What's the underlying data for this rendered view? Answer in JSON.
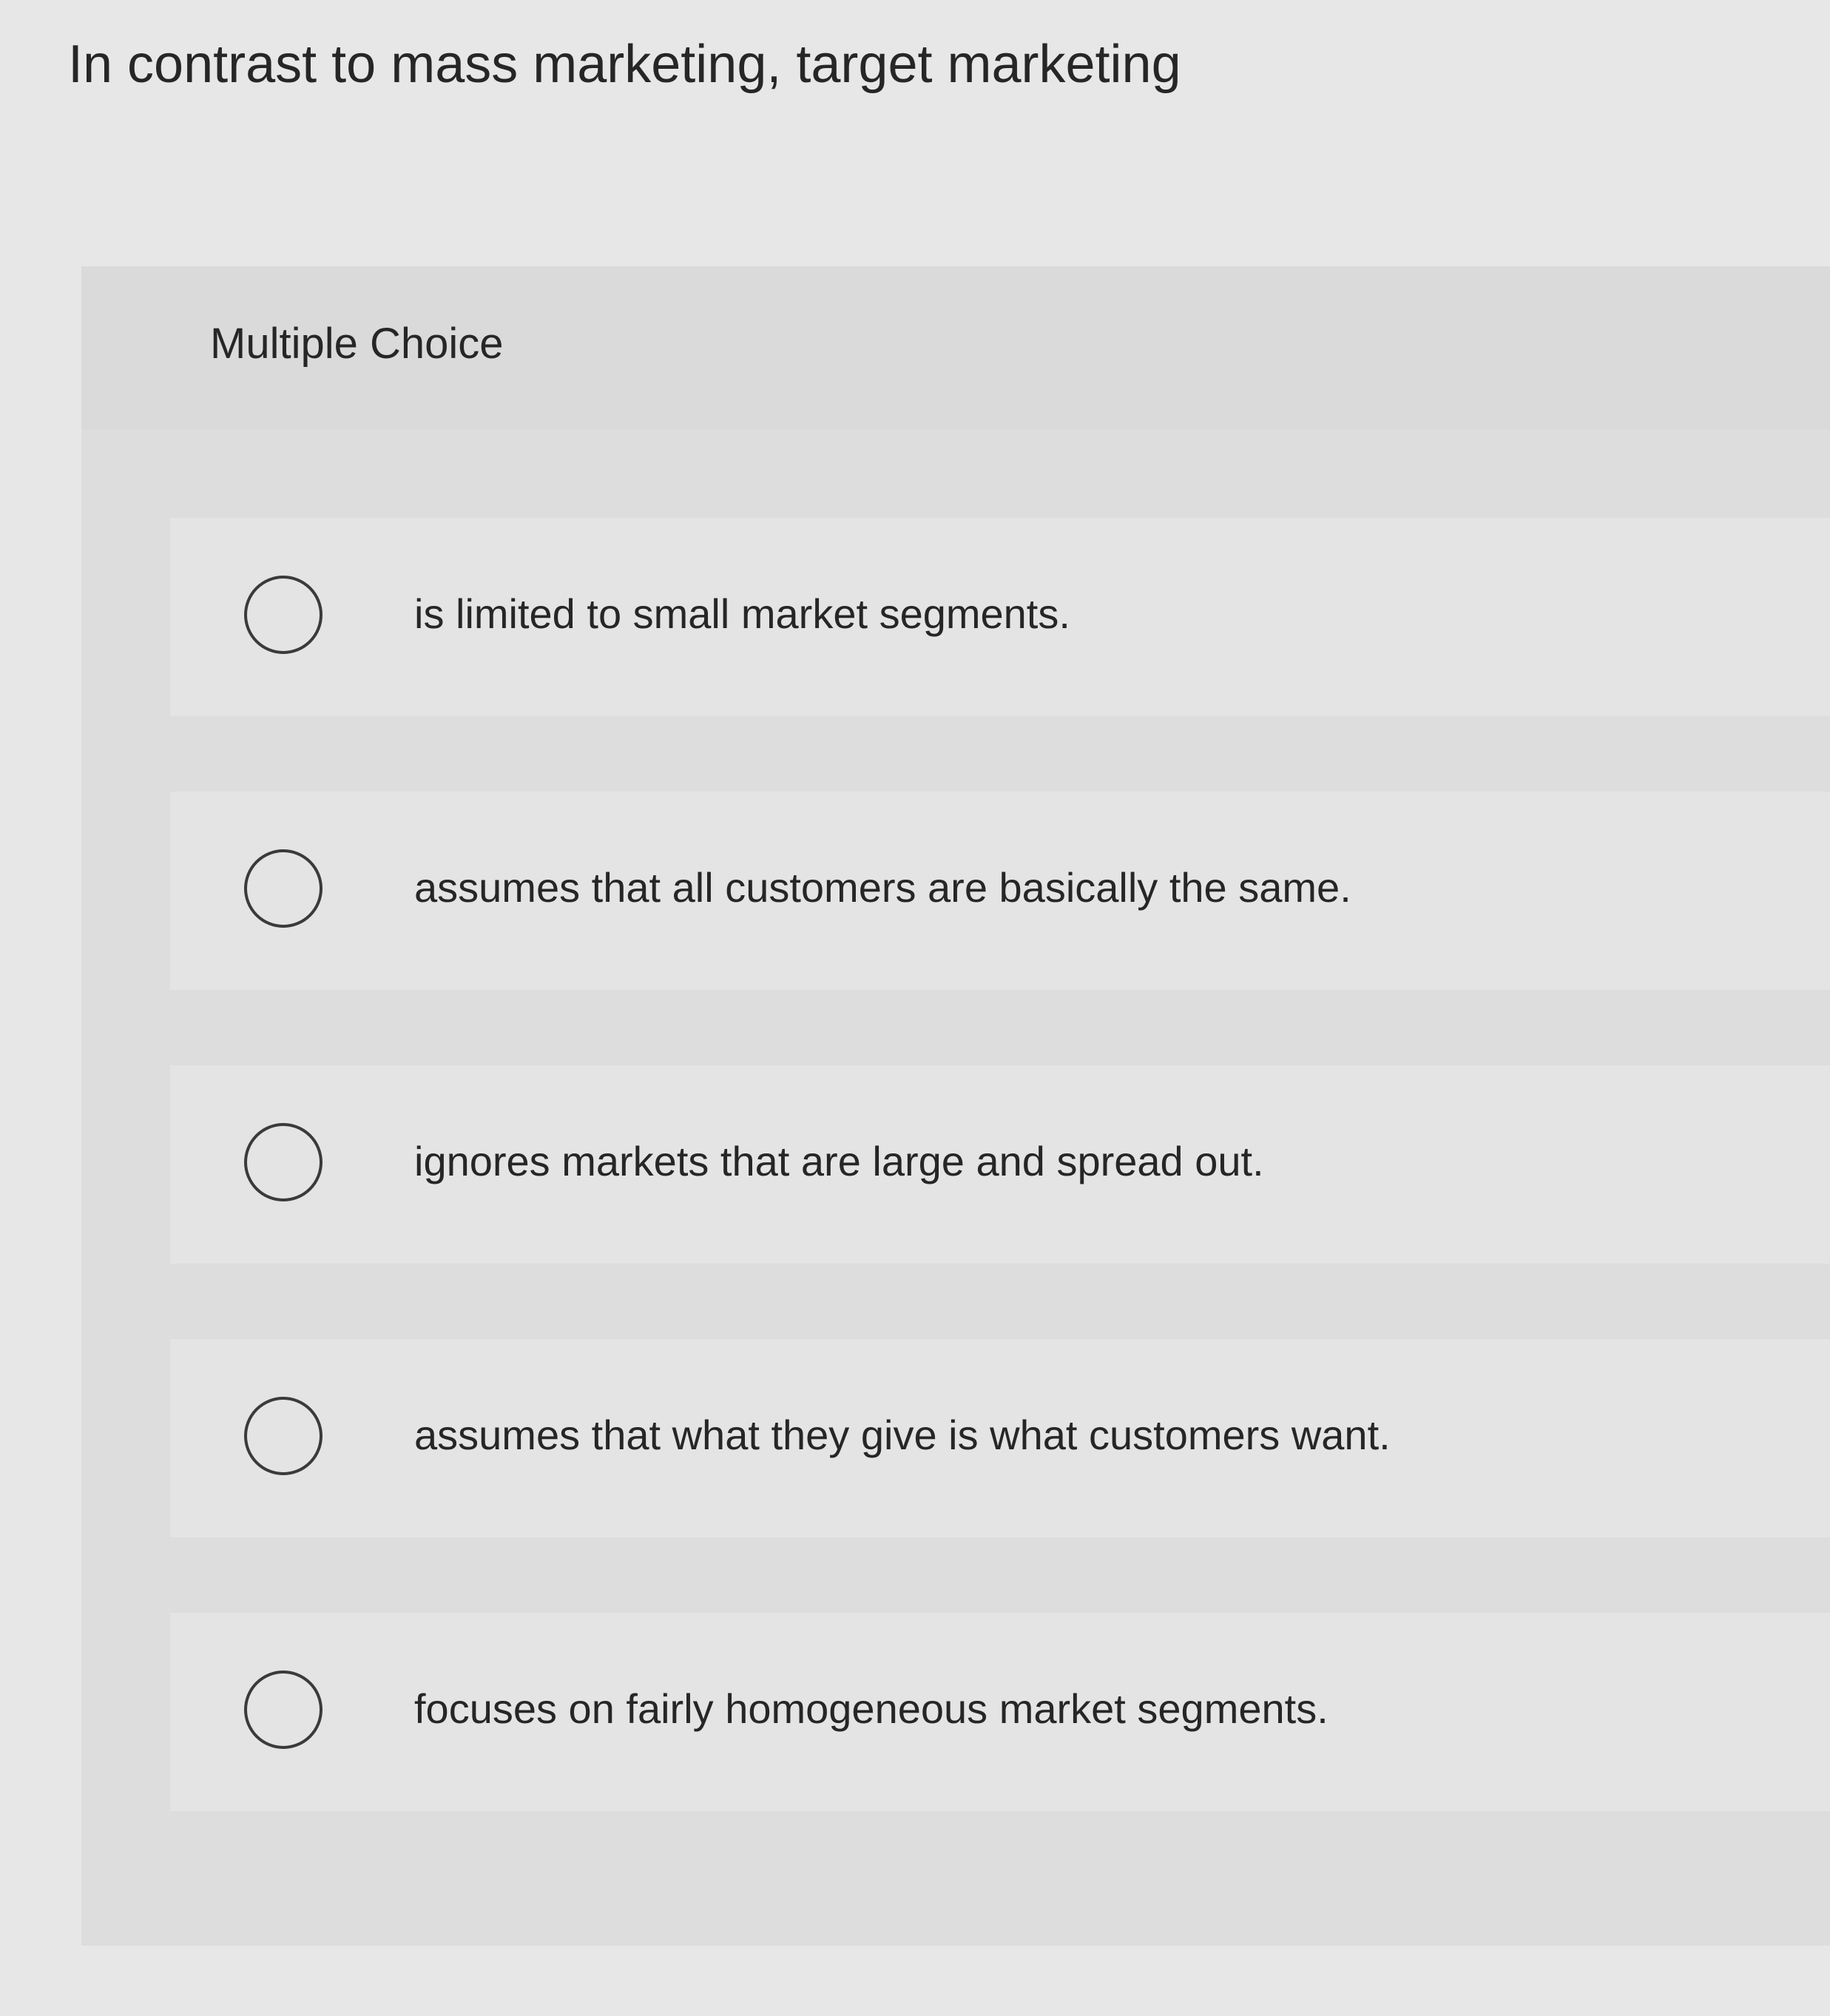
{
  "question": {
    "text": "In contrast to mass marketing, target marketing"
  },
  "choice_block": {
    "type_label": "Multiple Choice",
    "options": [
      {
        "label": "is limited to small market segments.",
        "selected": false
      },
      {
        "label": "assumes that all customers are basically the same.",
        "selected": false
      },
      {
        "label": "ignores markets that are large and spread out.",
        "selected": false
      },
      {
        "label": "assumes that what they give is what customers want.",
        "selected": false
      },
      {
        "label": "focuses on fairly homogeneous market segments.",
        "selected": false
      }
    ]
  },
  "icons": {
    "radio": "radio-unchecked-icon"
  },
  "colors": {
    "background": "#e6e7e6",
    "panel": "#dcdddc",
    "text": "#262626",
    "radio_border": "#3a3a3a"
  }
}
